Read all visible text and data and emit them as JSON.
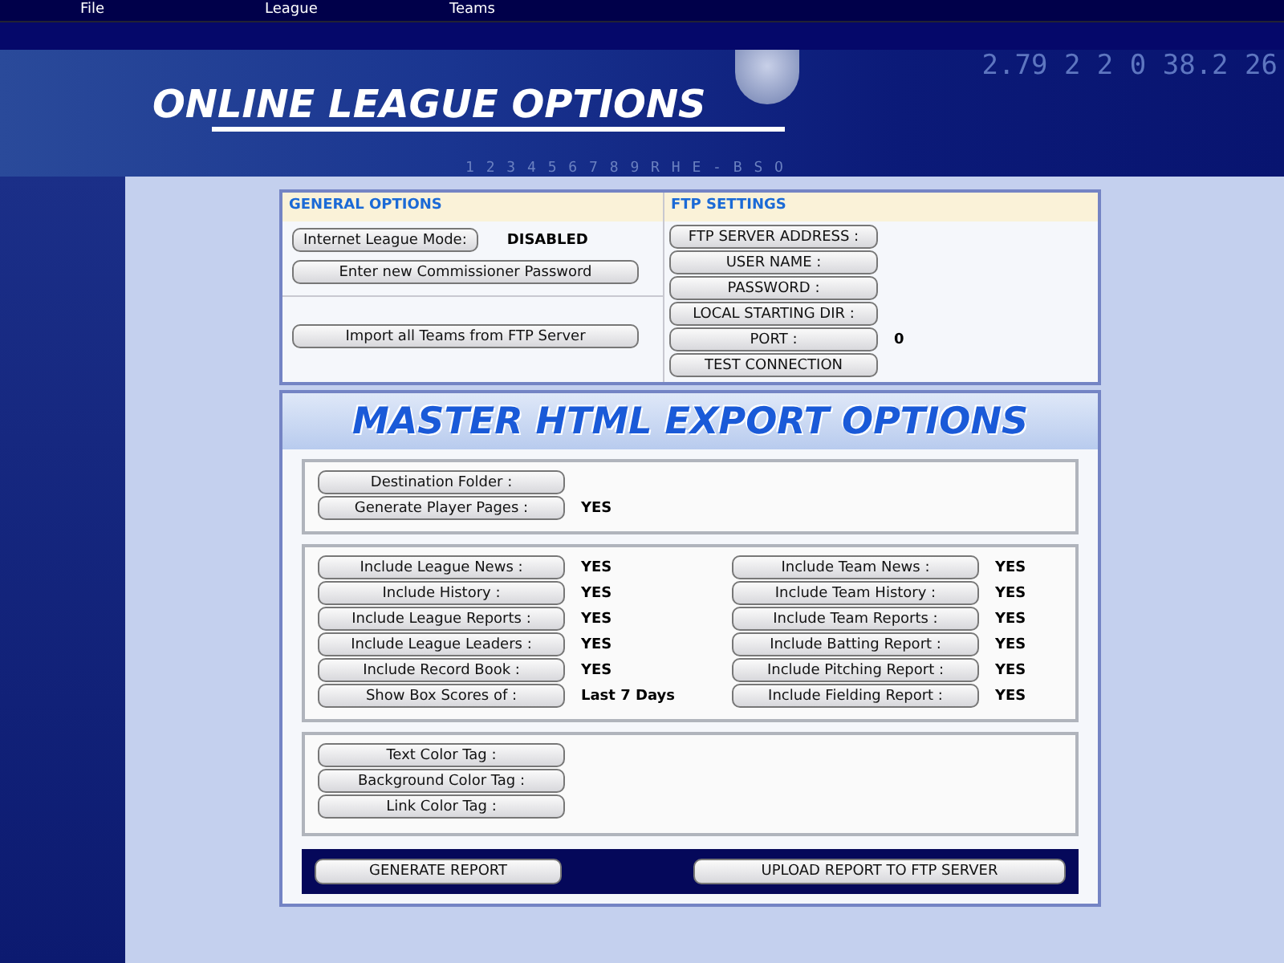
{
  "menu": [
    {
      "label": "File"
    },
    {
      "label": "League"
    },
    {
      "label": "Teams"
    }
  ],
  "header": {
    "title": "ONLINE LEAGUE OPTIONS",
    "scoreline": "2.79 2 2 0 38.2 26",
    "scoreboard_labels": "1 2 3 4 5 6 7 8 9 R H E - B S O"
  },
  "general_options": {
    "title": "GENERAL OPTIONS",
    "internet_mode": {
      "button": "Internet League Mode:",
      "value": "DISABLED"
    },
    "password_button": "Enter new Commissioner Password",
    "import_button": "Import all Teams from FTP Server"
  },
  "ftp_settings": {
    "title": "FTP SETTINGS",
    "fields": [
      {
        "button": "FTP SERVER ADDRESS :"
      },
      {
        "button": "USER NAME :"
      },
      {
        "button": "PASSWORD :"
      },
      {
        "button": "LOCAL STARTING DIR :"
      },
      {
        "button": "PORT :",
        "value": "0"
      },
      {
        "button": "TEST CONNECTION"
      }
    ]
  },
  "export": {
    "title": "MASTER HTML EXPORT OPTIONS",
    "output": [
      {
        "button": "Destination Folder :"
      },
      {
        "button": "Generate Player Pages :",
        "value": "YES"
      }
    ],
    "include_left": [
      {
        "button": "Include League News :",
        "value": "YES"
      },
      {
        "button": "Include History :",
        "value": "YES"
      },
      {
        "button": "Include League Reports :",
        "value": "YES"
      },
      {
        "button": "Include League Leaders :",
        "value": "YES"
      },
      {
        "button": "Include Record Book :",
        "value": "YES"
      },
      {
        "button": "Show Box Scores of :",
        "value": "Last 7 Days"
      }
    ],
    "include_right": [
      {
        "button": "Include Team News :",
        "value": "YES"
      },
      {
        "button": "Include Team History :",
        "value": "YES"
      },
      {
        "button": "Include Team Reports :",
        "value": "YES"
      },
      {
        "button": "Include Batting Report :",
        "value": "YES"
      },
      {
        "button": "Include Pitching Report :",
        "value": "YES"
      },
      {
        "button": "Include Fielding Report :",
        "value": "YES"
      }
    ],
    "colors": [
      {
        "button": "Text Color Tag :"
      },
      {
        "button": "Background Color Tag :"
      },
      {
        "button": "Link Color Tag :"
      }
    ],
    "actions": [
      {
        "label": "GENERATE REPORT"
      },
      {
        "label": "UPLOAD REPORT TO FTP SERVER"
      }
    ]
  }
}
